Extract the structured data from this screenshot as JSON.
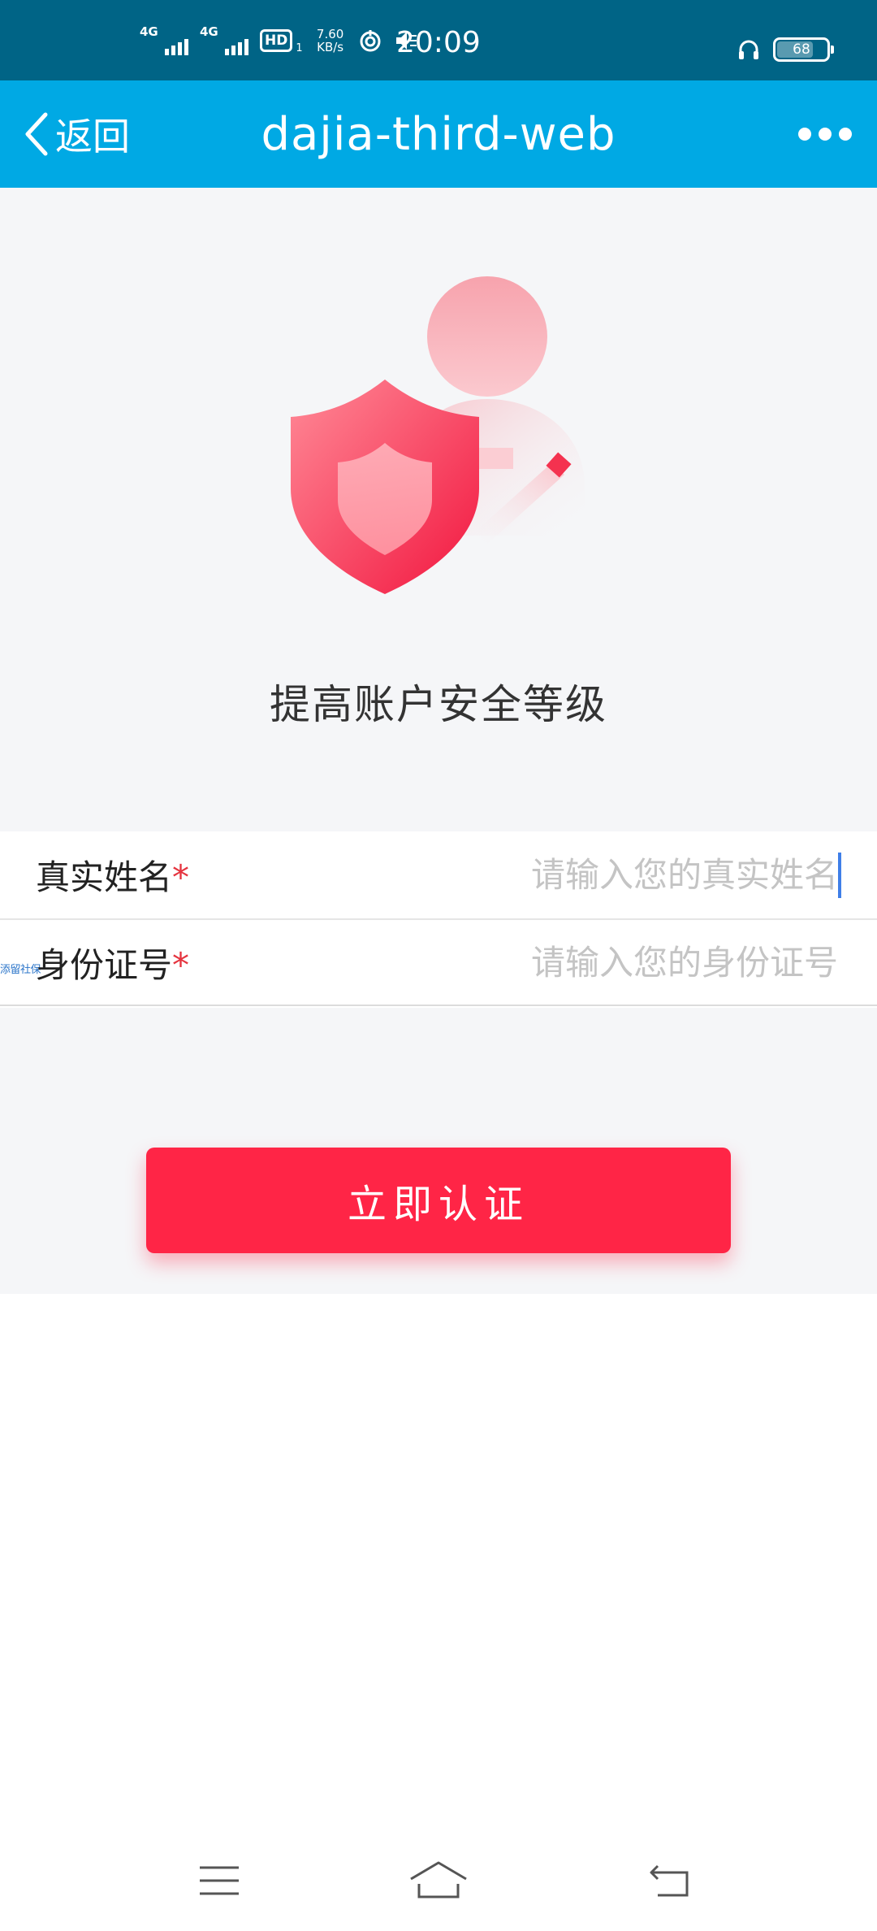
{
  "status_bar": {
    "network_1": "4G",
    "network_2": "4G",
    "hd_label": "HD",
    "hd_sub": "1",
    "speed_value": "7.60",
    "speed_unit": "KB/s",
    "time": "20:09",
    "battery_level": "68"
  },
  "title_bar": {
    "back_label": "返回",
    "title": "dajia-third-web"
  },
  "hero": {
    "heading": "提高账户安全等级"
  },
  "form": {
    "name_label": "真实姓名",
    "name_required": "*",
    "name_placeholder": "请输入您的真实姓名",
    "id_label": "身份证号",
    "id_required": "*",
    "id_placeholder": "请输入您的身份证号",
    "tiny_tag": "添留社保"
  },
  "actions": {
    "verify_label": "立即认证"
  },
  "colors": {
    "status_bar_bg": "#006486",
    "title_bar_bg": "#00a9e4",
    "primary_red": "#ff2546",
    "page_bg": "#f5f6f8"
  }
}
